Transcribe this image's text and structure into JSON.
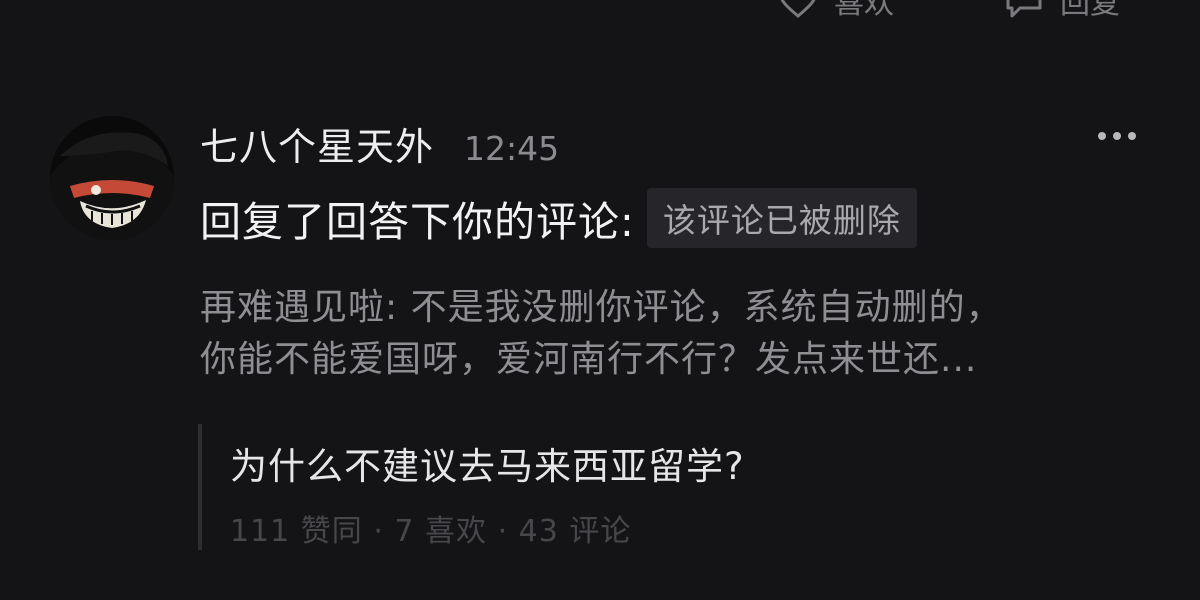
{
  "top_actions": {
    "like_label": "喜欢",
    "reply_label": "回复"
  },
  "comment": {
    "username": "七八个星天外",
    "time": "12:45",
    "reply_text": "回复了回答下你的评论:",
    "deleted_tag": "该评论已被删除",
    "quoted_lines": [
      "再难遇见啦: 不是我没删你评论，系统自动删的，",
      "你能不能爱国呀，爱河南行不行？发点来世还..."
    ]
  },
  "referenced_question": {
    "title": "为什么不建议去马来西亚留学?",
    "stats": "111 赞同 · 7 喜欢 · 43 评论"
  },
  "icons": {
    "like": "heart-icon",
    "reply": "speech-bubble-icon",
    "more": "more-dots-icon",
    "avatar": "avatar-image"
  },
  "colors": {
    "background": "#141416",
    "primary_text": "#ededee",
    "secondary_text": "#8e8e93",
    "tag_background": "#26262a"
  }
}
